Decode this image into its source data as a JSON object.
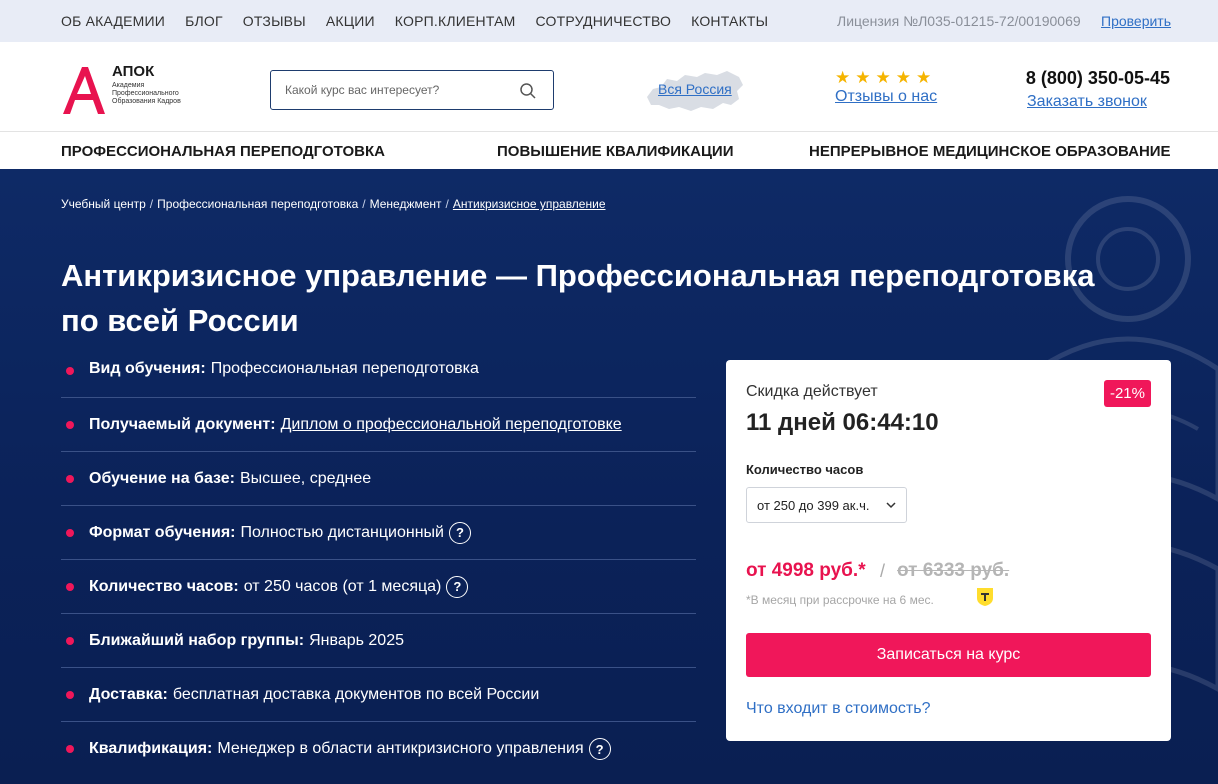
{
  "topbar": {
    "nav": [
      "ОБ АКАДЕМИИ",
      "БЛОГ",
      "ОТЗЫВЫ",
      "АКЦИИ",
      "КОРП.КЛИЕНТАМ",
      "СОТРУДНИЧЕСТВО",
      "КОНТАКТЫ"
    ],
    "license": "Лицензия №Л035-01215-72/00190069",
    "verify": "Проверить"
  },
  "header": {
    "logo_name": "АПОК",
    "logo_sub": "Академия Профессионального Образования Кадров",
    "search_placeholder": "Какой курс вас интересует?",
    "region": "Вся Россия",
    "reviews": "Отзывы о нас",
    "phone": "8 (800) 350-05-45",
    "callback": "Заказать звонок"
  },
  "catnav": [
    "ПРОФЕССИОНАЛЬНАЯ ПЕРЕПОДГОТОВКА",
    "ПОВЫШЕНИЕ КВАЛИФИКАЦИИ",
    "НЕПРЕРЫВНОЕ МЕДИЦИНСКОЕ ОБРАЗОВАНИЕ"
  ],
  "breadcrumb": [
    "Учебный центр",
    "Профессиональная переподготовка",
    "Менеджмент",
    "Антикризисное управление"
  ],
  "title_line1": "Антикризисное управление — Профессиональная переподготовка",
  "title_line2": "по всей России",
  "facts": [
    {
      "label": "Вид обучения:",
      "value": "Профессиональная переподготовка"
    },
    {
      "label": "Получаемый документ:",
      "value": "Диплом о профессиональной переподготовке"
    },
    {
      "label": "Обучение на базе:",
      "value": "Высшее, среднее"
    },
    {
      "label": "Формат обучения:",
      "value": "Полностью дистанционный"
    },
    {
      "label": "Количество часов:",
      "value": "от 250 часов (от 1 месяца)"
    },
    {
      "label": "Ближайший набор группы:",
      "value": "Январь 2025"
    },
    {
      "label": "Доставка:",
      "value": "бесплатная доставка документов по всей России"
    },
    {
      "label": "Квалификация:",
      "value": "Менеджер в области антикризисного управления"
    }
  ],
  "help_glyph": "?",
  "card": {
    "discount_label": "Скидка действует",
    "timer": "11 дней 06:44:10",
    "badge": "-21%",
    "hours_label": "Количество часов",
    "hours_value": "от 250 до 399 ак.ч.",
    "price": "от 4998 руб.*",
    "slash": "/",
    "old_price": "от 6333 руб.",
    "note": "*В месяц при рассрочке на 6 мес.",
    "cta": "Записаться на курс",
    "what_included": "Что входит в стоимость?"
  },
  "icons": {
    "search": "search-icon",
    "star": "star-icon",
    "help": "question-circle-icon",
    "chevron": "chevron-down-icon",
    "bank": "tinkoff-logo-icon"
  },
  "colors": {
    "accent": "#f0175a",
    "link": "#2f6fc5",
    "hero": "#0b2259",
    "star": "#f5b400"
  },
  "rating": 5
}
